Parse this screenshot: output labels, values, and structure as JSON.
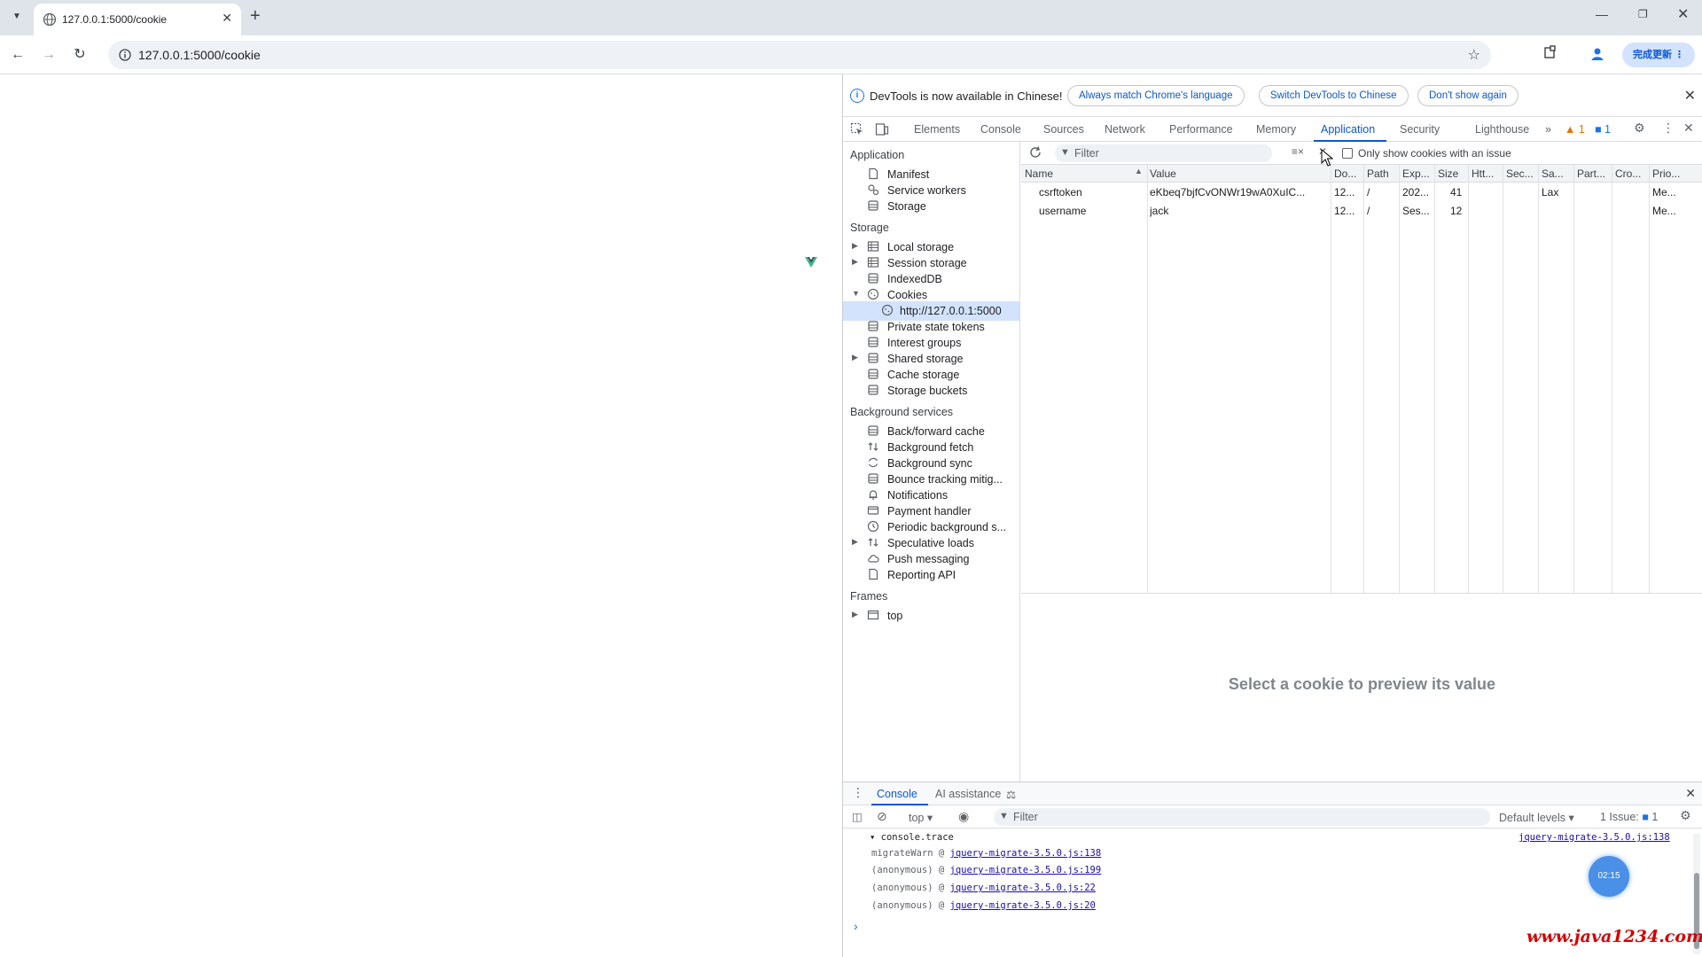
{
  "browser": {
    "tab_title": "127.0.0.1:5000/cookie",
    "url": "127.0.0.1:5000/cookie",
    "update_label": "完成更新"
  },
  "infobar": {
    "text": "DevTools is now available in Chinese!",
    "btn_match": "Always match Chrome's language",
    "btn_switch": "Switch DevTools to Chinese",
    "btn_dont": "Don't show again"
  },
  "devtools_tabs": [
    "Elements",
    "Console",
    "Sources",
    "Network",
    "Performance",
    "Memory",
    "Application",
    "Security",
    "Lighthouse"
  ],
  "devtools_badges": {
    "warnings": "1",
    "issues": "1"
  },
  "sidebar": {
    "application_head": "Application",
    "application": [
      "Manifest",
      "Service workers",
      "Storage"
    ],
    "storage_head": "Storage",
    "storage": [
      "Local storage",
      "Session storage",
      "IndexedDB",
      "Cookies",
      "http://127.0.0.1:5000",
      "Private state tokens",
      "Interest groups",
      "Shared storage",
      "Cache storage",
      "Storage buckets"
    ],
    "background_head": "Background services",
    "background": [
      "Back/forward cache",
      "Background fetch",
      "Background sync",
      "Bounce tracking mitig...",
      "Notifications",
      "Payment handler",
      "Periodic background s...",
      "Speculative loads",
      "Push messaging",
      "Reporting API"
    ],
    "frames_head": "Frames",
    "frames": [
      "top"
    ]
  },
  "cookies": {
    "filter_placeholder": "Filter",
    "only_issue_label": "Only show cookies with an issue",
    "columns": [
      "Name",
      "Value",
      "Do...",
      "Path",
      "Exp...",
      "Size",
      "Htt...",
      "Sec...",
      "Sa...",
      "Part...",
      "Cro...",
      "Prio..."
    ],
    "rows": [
      [
        "csrftoken",
        "eKbeq7bjfCvONWr19wA0XuIC...",
        "12...",
        "/",
        "202...",
        "41",
        "",
        "",
        "Lax",
        "",
        "",
        "Me..."
      ],
      [
        "username",
        "jack",
        "12...",
        "/",
        "Ses...",
        "12",
        "",
        "",
        "",
        "",
        "",
        "Me..."
      ]
    ],
    "preview_msg": "Select a cookie to preview its value"
  },
  "drawer": {
    "tab_console": "Console",
    "tab_ai": "AI assistance",
    "context": "top",
    "filter_placeholder": "Filter",
    "levels": "Default levels",
    "issues_label": "1 Issue:",
    "issues_count": "1",
    "trace_header": "console.trace",
    "trace_source": "jquery-migrate-3.5.0.js:138",
    "trace": [
      {
        "fn": "migrateWarn",
        "src": "jquery-migrate-3.5.0.js:138"
      },
      {
        "fn": "(anonymous)",
        "src": "jquery-migrate-3.5.0.js:199"
      },
      {
        "fn": "(anonymous)",
        "src": "jquery-migrate-3.5.0.js:22"
      },
      {
        "fn": "(anonymous)",
        "src": "jquery-migrate-3.5.0.js:20"
      }
    ],
    "prompt": "›"
  },
  "overlay_badge": "02:15",
  "watermark": "www.java1234.com",
  "colors": {
    "accent": "#0b57d0",
    "selected_bg": "#d3e3fd",
    "warning": "#e37400",
    "watermark": "#d40000"
  }
}
